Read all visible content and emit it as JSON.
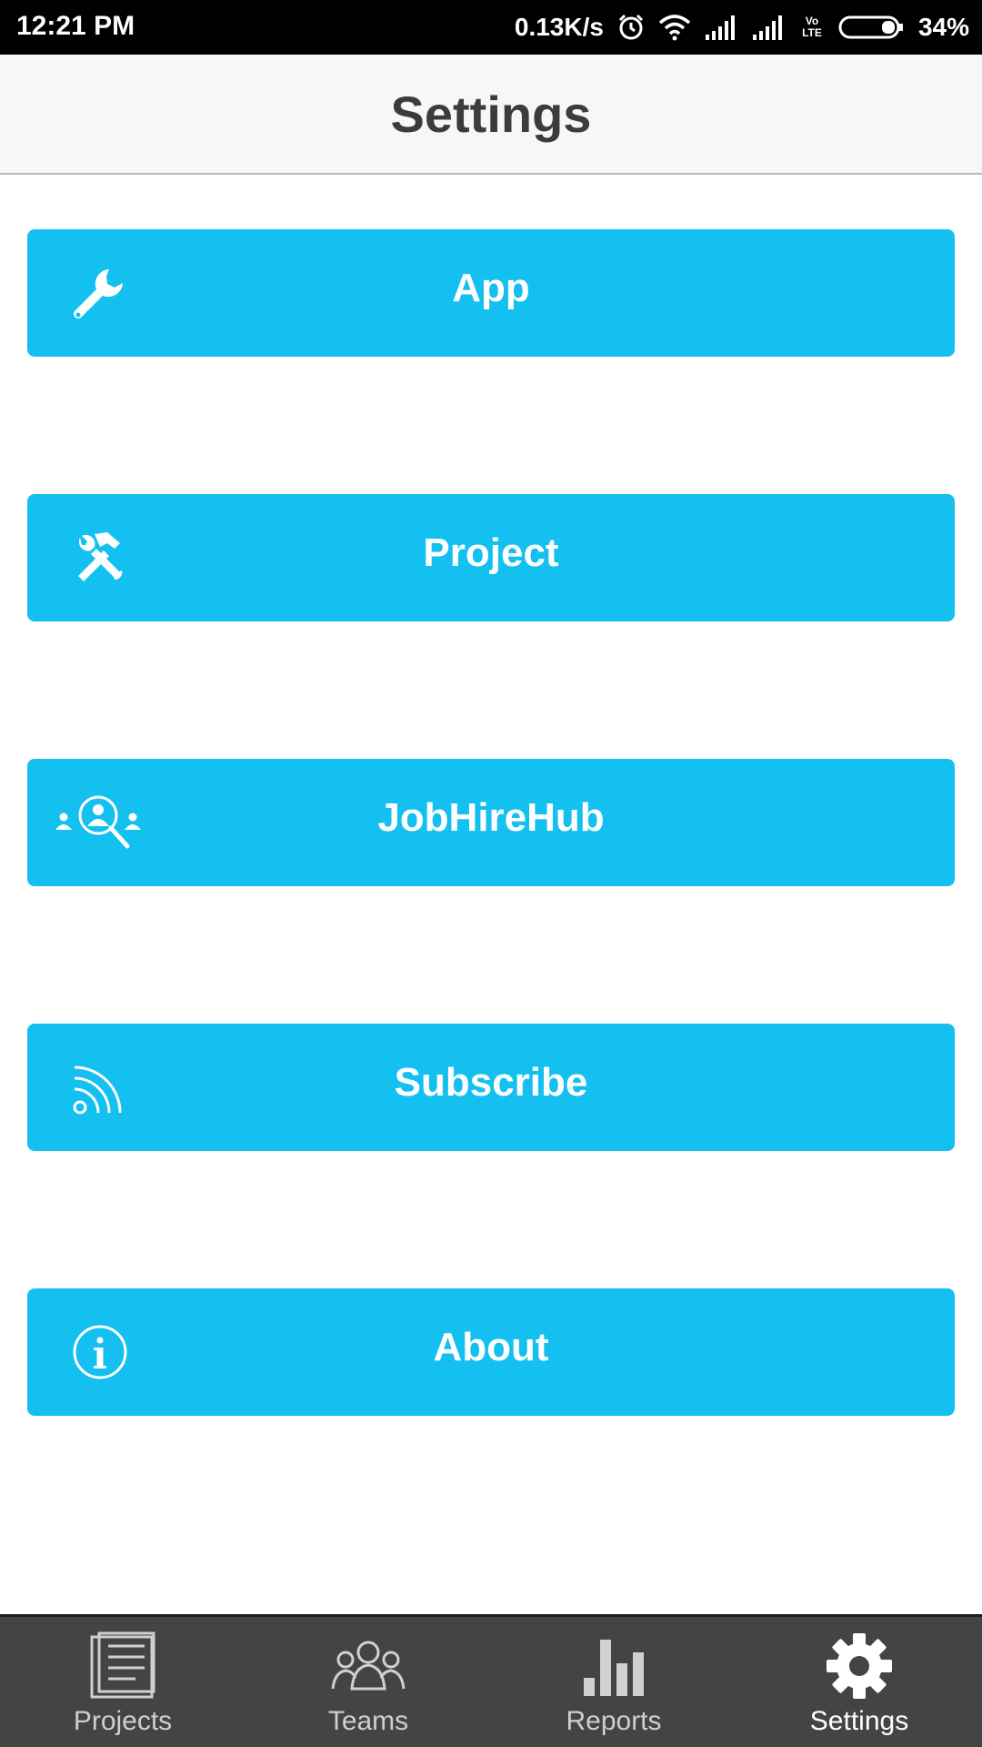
{
  "status_bar": {
    "time": "12:21 PM",
    "network_speed": "0.13K/s",
    "volte": "Vo LTE",
    "battery": "34%",
    "icons": [
      "alarm-icon",
      "wifi-icon",
      "signal-icon",
      "signal-icon",
      "volte-icon",
      "battery-icon"
    ]
  },
  "header": {
    "title": "Settings"
  },
  "menu": [
    {
      "label": "App",
      "icon": "wrench-icon"
    },
    {
      "label": "Project",
      "icon": "tools-icon"
    },
    {
      "label": "JobHireHub",
      "icon": "people-search-icon"
    },
    {
      "label": "Subscribe",
      "icon": "rss-icon"
    },
    {
      "label": "About",
      "icon": "info-icon"
    }
  ],
  "bottom_nav": [
    {
      "label": "Projects",
      "icon": "document-icon",
      "active": false
    },
    {
      "label": "Teams",
      "icon": "team-icon",
      "active": false
    },
    {
      "label": "Reports",
      "icon": "bar-chart-icon",
      "active": false
    },
    {
      "label": "Settings",
      "icon": "gear-icon",
      "active": true
    }
  ],
  "colors": {
    "accent": "#13c0f0",
    "header_bg": "#f7f7f7",
    "nav_bg": "#444444",
    "status_bg": "#000000"
  }
}
